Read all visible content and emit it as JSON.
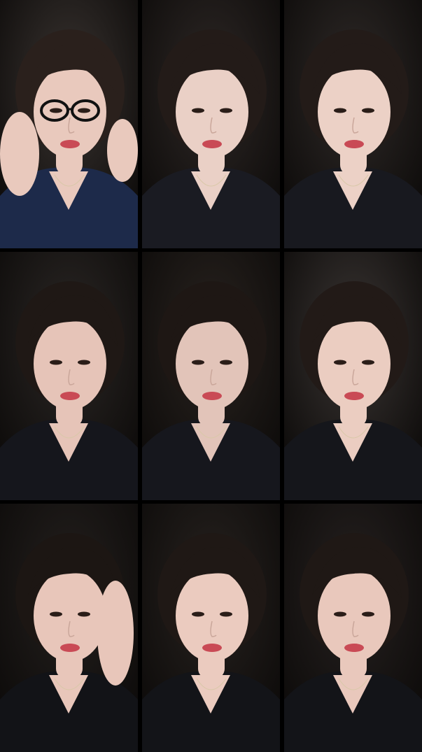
{
  "layout": {
    "columns": 3,
    "rows": 3,
    "background_color": "#000000"
  },
  "frames": [
    {
      "bg": "#3a3431",
      "shirt": "#1d2a4a",
      "skin": "#e9c9bd",
      "hair": "#2a201c",
      "glasses": true,
      "hand": "both-glasses"
    },
    {
      "bg": "#2e2826",
      "shirt": "#1a1b22",
      "skin": "#ead0c6",
      "hair": "#231b18",
      "glasses": false,
      "hand": "none"
    },
    {
      "bg": "#2f2a28",
      "shirt": "#18191f",
      "skin": "#ecd1c6",
      "hair": "#231b18",
      "glasses": false,
      "hand": "none"
    },
    {
      "bg": "#2b2725",
      "shirt": "#15161c",
      "skin": "#e6c4b8",
      "hair": "#1f1815",
      "glasses": false,
      "hand": "none"
    },
    {
      "bg": "#29231f",
      "shirt": "#16171d",
      "skin": "#e2c4b9",
      "hair": "#1e1714",
      "glasses": false,
      "hand": "none"
    },
    {
      "bg": "#3a3533",
      "shirt": "#15161b",
      "skin": "#ebcdc1",
      "hair": "#221a17",
      "glasses": false,
      "hand": "none"
    },
    {
      "bg": "#24201e",
      "shirt": "#121317",
      "skin": "#e8c6ba",
      "hair": "#1c1613",
      "glasses": false,
      "hand": "face"
    },
    {
      "bg": "#27221f",
      "shirt": "#131418",
      "skin": "#ebcbbf",
      "hair": "#1f1815",
      "glasses": false,
      "hand": "none"
    },
    {
      "bg": "#262120",
      "shirt": "#131418",
      "skin": "#e9c8bc",
      "hair": "#1f1815",
      "glasses": false,
      "hand": "none"
    }
  ]
}
